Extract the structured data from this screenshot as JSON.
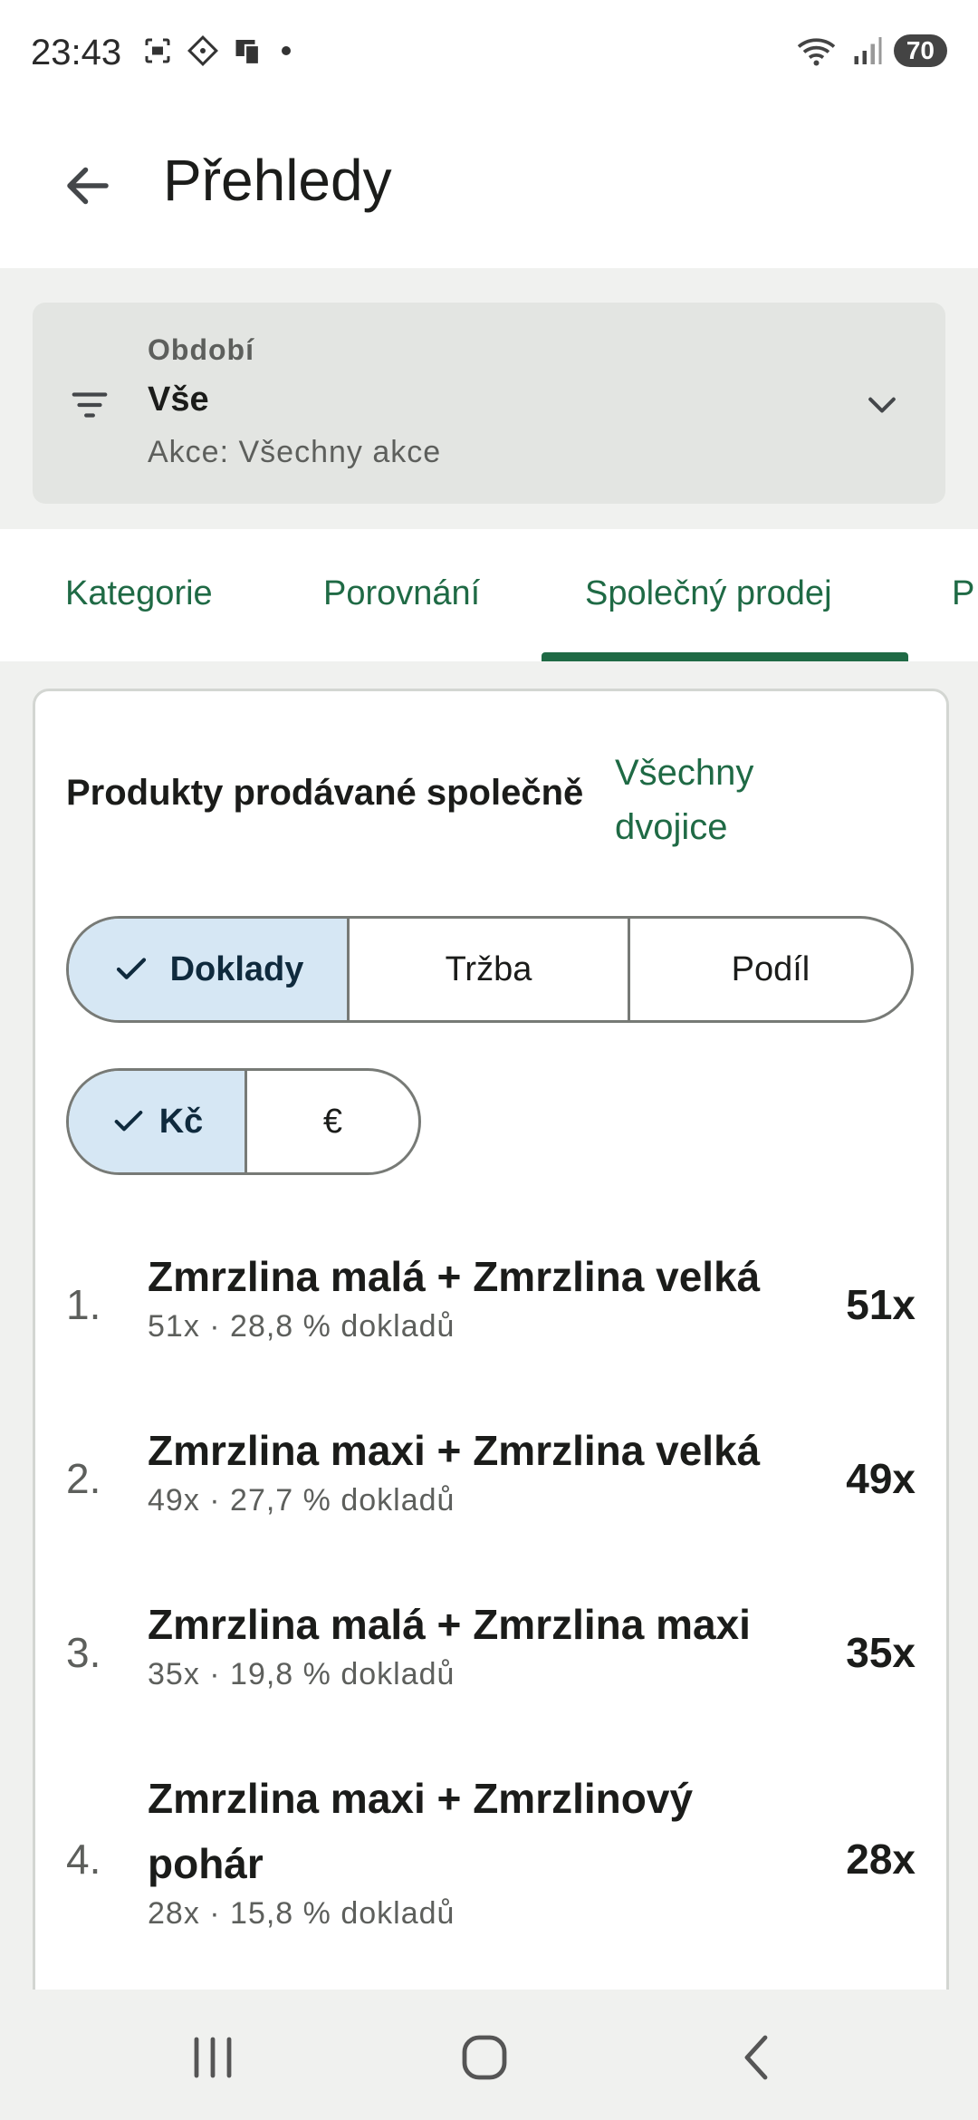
{
  "status_bar": {
    "time": "23:43",
    "battery": "70"
  },
  "app_bar": {
    "title": "Přehledy"
  },
  "filter": {
    "label": "Období",
    "value": "Vše",
    "subtitle": "Akce: Všechny akce"
  },
  "tabs": [
    {
      "label": "Kategorie",
      "selected": false
    },
    {
      "label": "Porovnání",
      "selected": false
    },
    {
      "label": "Společný prodej",
      "selected": true
    },
    {
      "label": "P",
      "selected": false
    }
  ],
  "card": {
    "title": "Produkty prodávané společně",
    "all_pairs_link": "Všechny dvojice",
    "metric_options": [
      "Doklady",
      "Tržba",
      "Podíl"
    ],
    "metric_selected": "Doklady",
    "currency_options": [
      "Kč",
      "€"
    ],
    "currency_selected": "Kč",
    "items": [
      {
        "rank": "1.",
        "pair": "Zmrzlina malá + Zmrzlina velká",
        "detail": "51x · 28,8 % dokladů",
        "count": "51x"
      },
      {
        "rank": "2.",
        "pair": "Zmrzlina maxi + Zmrzlina velká",
        "detail": "49x · 27,7 % dokladů",
        "count": "49x"
      },
      {
        "rank": "3.",
        "pair": "Zmrzlina malá + Zmrzlina maxi",
        "detail": "35x · 19,8 % dokladů",
        "count": "35x"
      },
      {
        "rank": "4.",
        "pair": "Zmrzlina maxi + Zmrzlinový pohár",
        "detail": "28x · 15,8 % dokladů",
        "count": "28x"
      }
    ]
  },
  "colors": {
    "accent": "#1f6a45",
    "selected_chip": "#d6e7f4",
    "surface": "#f0f1ef"
  },
  "icons": [
    "back-arrow-icon",
    "filter-icon",
    "chevron-down-icon",
    "check-icon",
    "recents-icon",
    "home-icon",
    "nav-back-icon"
  ]
}
